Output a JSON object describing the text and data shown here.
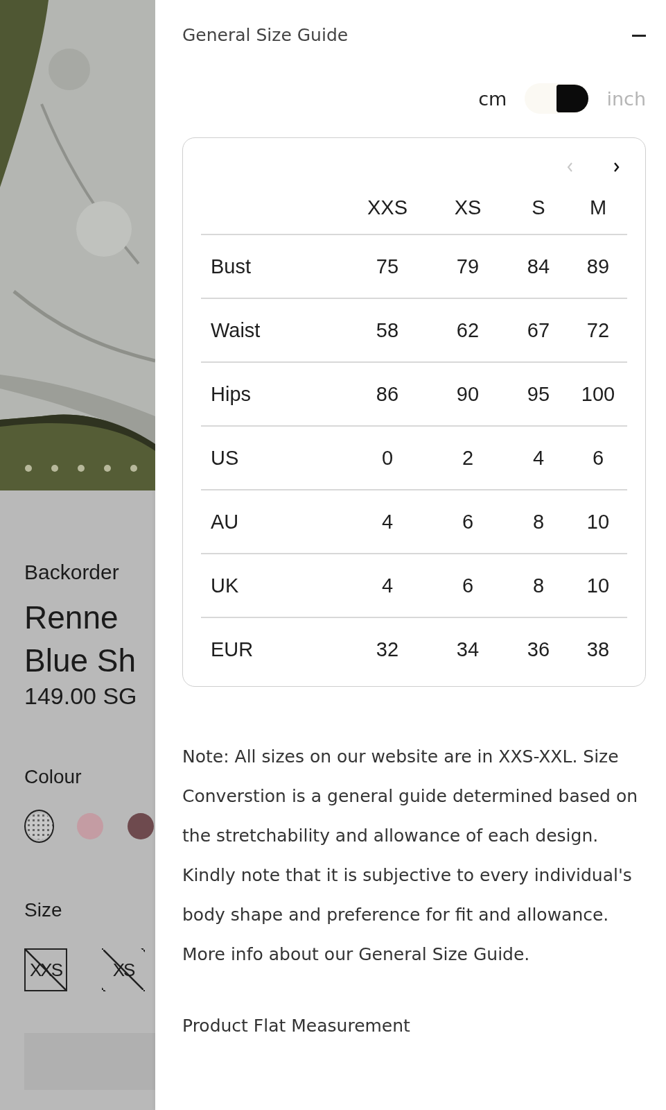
{
  "product": {
    "carousel_dots": [
      {
        "selected": false
      },
      {
        "selected": false
      },
      {
        "selected": false
      },
      {
        "selected": false
      },
      {
        "selected": false
      }
    ],
    "availability": "Backorder",
    "name_lines": [
      "Renne",
      "Blue Sh"
    ],
    "price": "149.00 SG",
    "colour_label": "Colour",
    "colours": [
      {
        "color": "#c7c7c7",
        "selected": true,
        "kind": "pattern"
      },
      {
        "color": "#c49ca3",
        "selected": false,
        "kind": "solid"
      },
      {
        "color": "#6e4a4e",
        "selected": false,
        "kind": "solid"
      }
    ],
    "size_label": "Size",
    "sizes": [
      {
        "label": "XXS",
        "selected": true,
        "unavailable": true
      },
      {
        "label": "XS",
        "selected": false,
        "unavailable": true
      }
    ]
  },
  "size_guide": {
    "title": "General Size Guide",
    "expanded": true,
    "units": [
      {
        "label": "cm",
        "selected": true
      },
      {
        "label": "inch",
        "selected": false
      }
    ],
    "unit_toggle": {
      "on": true
    },
    "pager": {
      "prev_disabled": true,
      "next_disabled": false
    },
    "table": {
      "columns": [
        "XXS",
        "XS",
        "S",
        "M"
      ],
      "rows": [
        {
          "label": "Bust",
          "cells": [
            "75",
            "79",
            "84",
            "89"
          ]
        },
        {
          "label": "Waist",
          "cells": [
            "58",
            "62",
            "67",
            "72"
          ]
        },
        {
          "label": "Hips",
          "cells": [
            "86",
            "90",
            "95",
            "100"
          ]
        },
        {
          "label": "US",
          "cells": [
            "0",
            "2",
            "4",
            "6"
          ]
        },
        {
          "label": "AU",
          "cells": [
            "4",
            "6",
            "8",
            "10"
          ]
        },
        {
          "label": "UK",
          "cells": [
            "4",
            "6",
            "8",
            "10"
          ]
        },
        {
          "label": "EUR",
          "cells": [
            "32",
            "34",
            "36",
            "38"
          ]
        }
      ]
    },
    "note": "Note: All sizes on our website are in XXS-XXL. Size Converstion is a general guide determined based on the stretchability and allowance of each design. Kindly note that it is subjective to every individual's body shape and preference for fit and allowance. More info about our General Size Guide."
  },
  "next_section": {
    "title": "Product Flat Measurement"
  }
}
